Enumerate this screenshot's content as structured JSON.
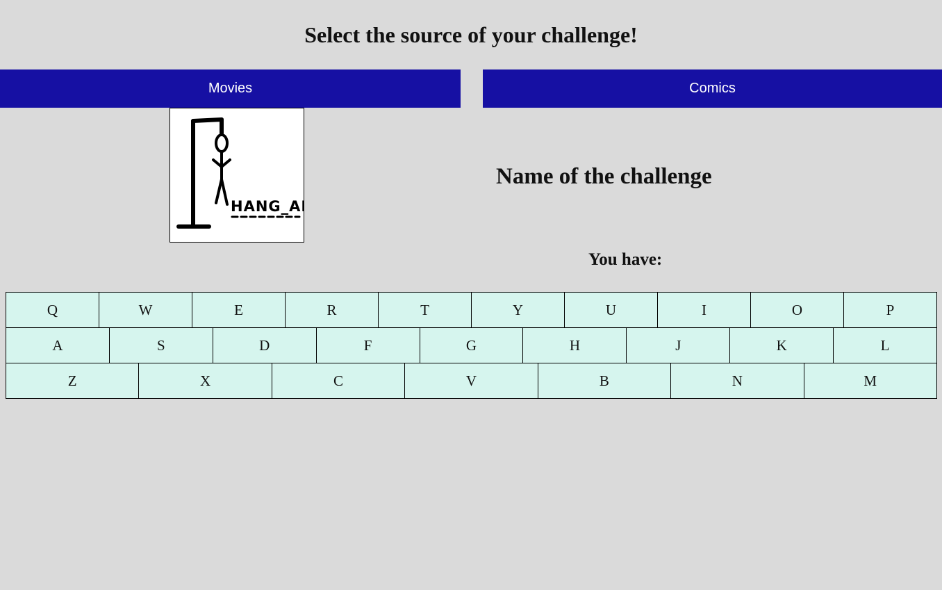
{
  "header": {
    "title": "Select the source of your challenge!"
  },
  "sources": {
    "movies_label": "Movies",
    "comics_label": "Comics"
  },
  "logo": {
    "text": "HANG_AN",
    "icon": "hangman-logo"
  },
  "challenge": {
    "name": "Name of the challenge",
    "you_have_label": "You have:"
  },
  "keyboard": {
    "rows": [
      [
        "Q",
        "W",
        "E",
        "R",
        "T",
        "Y",
        "U",
        "I",
        "O",
        "P"
      ],
      [
        "A",
        "S",
        "D",
        "F",
        "G",
        "H",
        "J",
        "K",
        "L"
      ],
      [
        "Z",
        "X",
        "C",
        "V",
        "B",
        "N",
        "M"
      ]
    ]
  },
  "colors": {
    "background": "#dadada",
    "button_bg": "#1610a3",
    "button_text": "#ffffff",
    "key_bg": "#d6f5ee"
  }
}
